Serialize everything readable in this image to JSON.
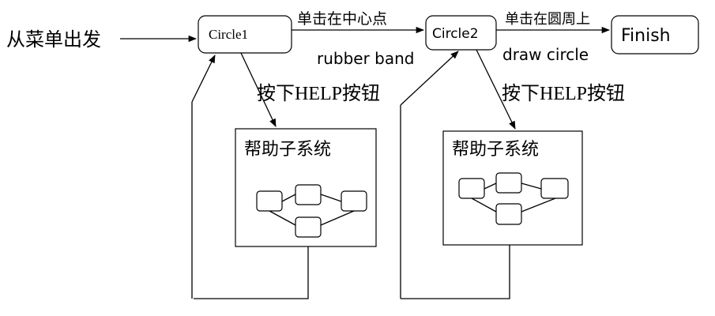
{
  "start_label": "从菜单出发",
  "states": {
    "circle1": "Circle1",
    "circle2": "Circle2",
    "finish": "Finish"
  },
  "transitions": {
    "c1_to_c2_top": "单击在中心点",
    "c1_to_c2_bottom": "rubber band",
    "c2_to_finish_top": "单击在圆周上",
    "c2_to_finish_bottom": "draw circle",
    "help_1": "按下HELP按钮",
    "help_2": "按下HELP按钮"
  },
  "help_panels": {
    "panel1_title": "帮助子系统",
    "panel2_title": "帮助子系统"
  }
}
